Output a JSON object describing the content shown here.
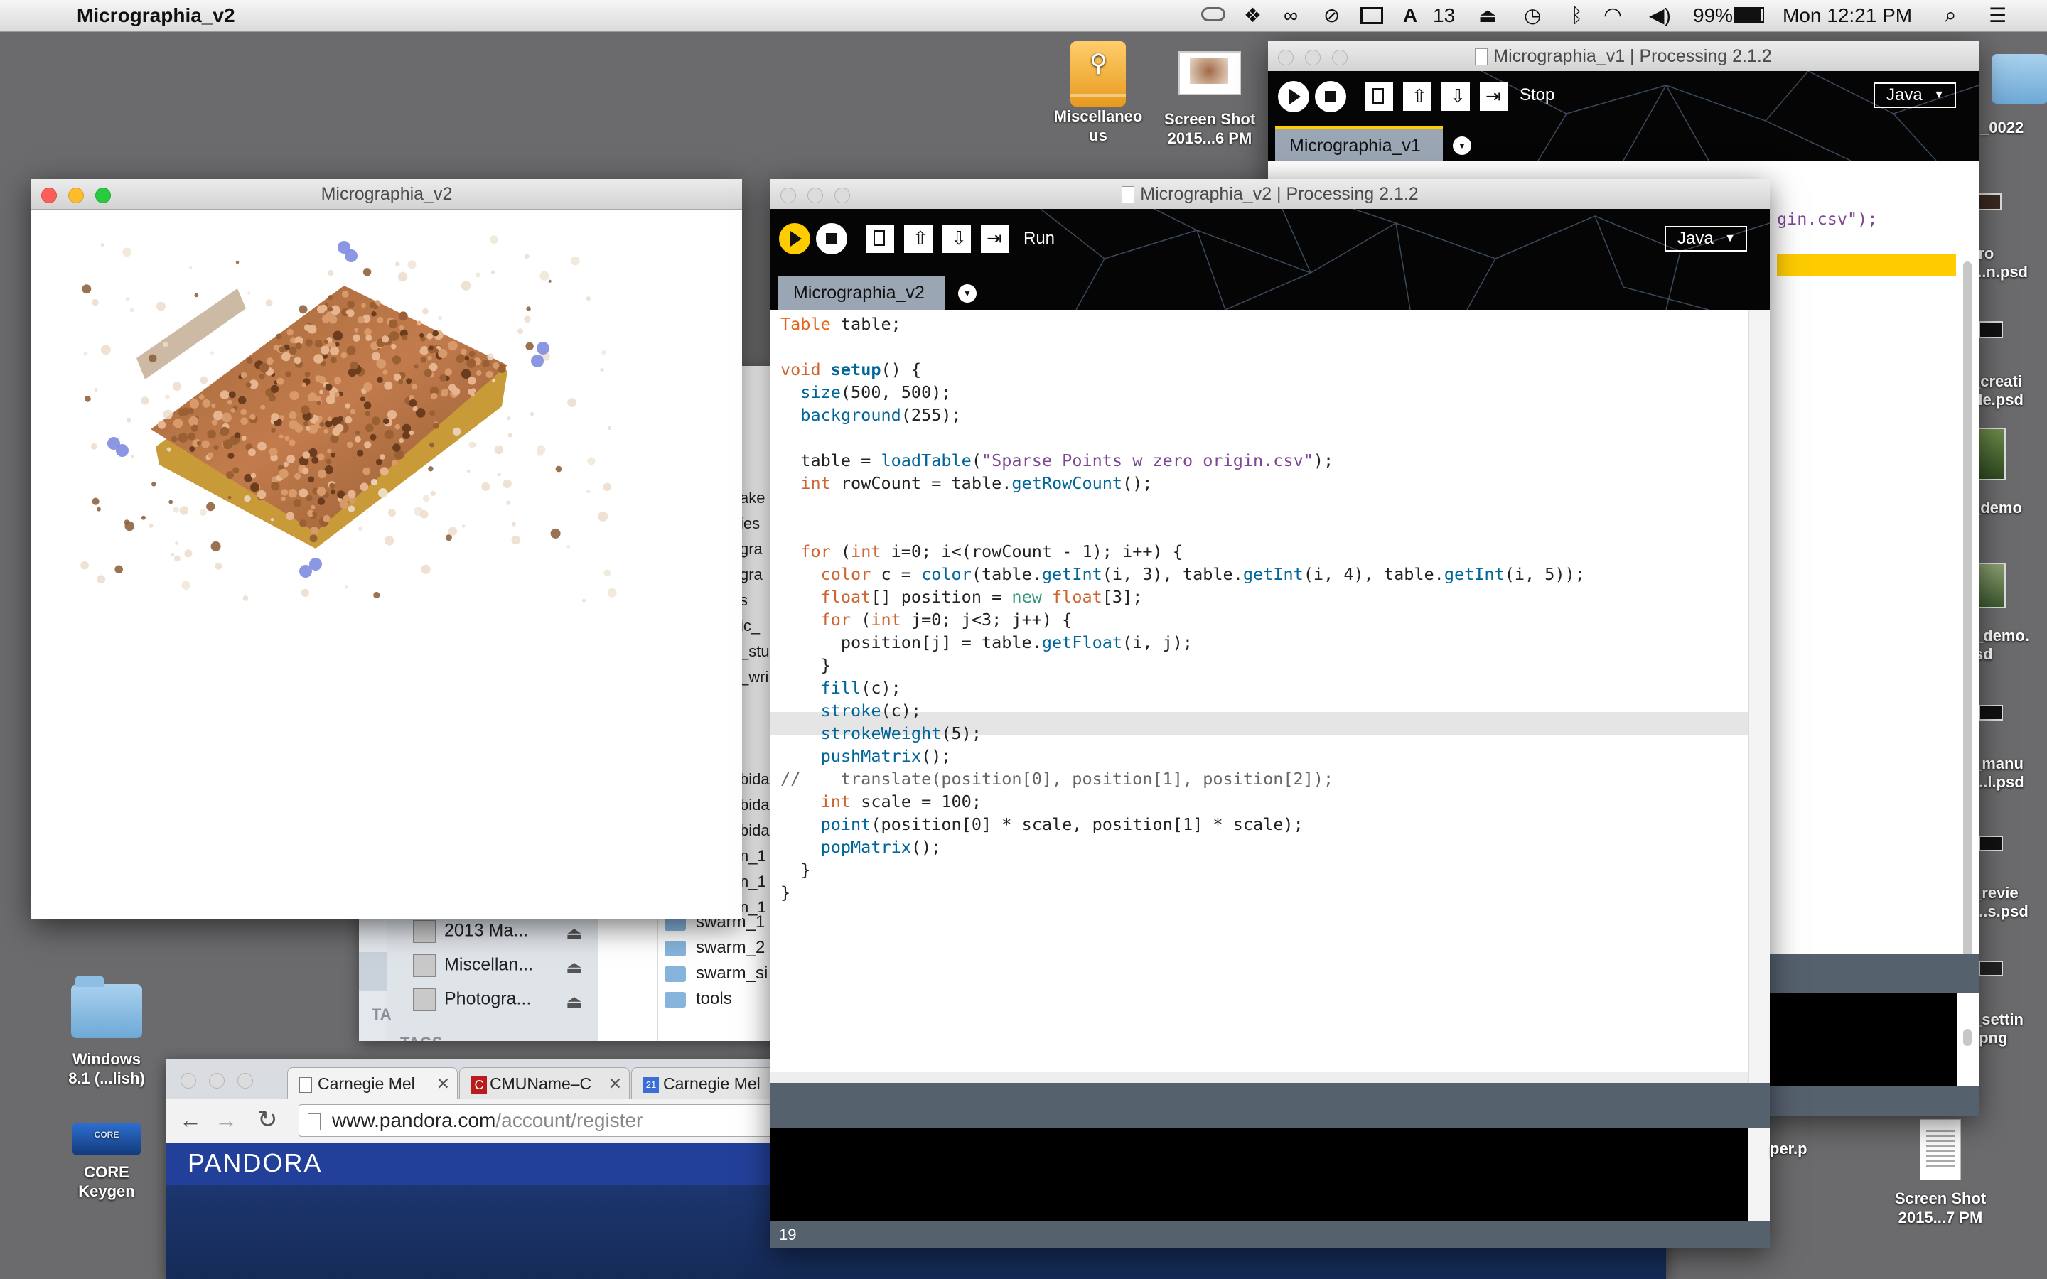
{
  "menubar": {
    "app_name": "Micrographia_v2",
    "status_icons": [
      "cloud-icon",
      "dropbox-icon",
      "creative-cloud-icon",
      "sync-icon",
      "display-icon",
      "adobe-icon",
      "airplay-icon",
      "time-machine-icon",
      "bluetooth-icon",
      "wifi-icon",
      "volume-icon"
    ],
    "adobe_count": "13",
    "battery": "99%",
    "clock": "Mon 12:21 PM"
  },
  "desktop": {
    "icons": [
      {
        "label_line1": "Miscellaneo",
        "label_line2": "us",
        "icon": "usb-drive-icon"
      },
      {
        "label_line1": "Screen Shot",
        "label_line2": "2015...6 PM",
        "icon": "screenshot-thumb"
      },
      {
        "label_line1": "Windows",
        "label_line2": "8.1 (...lish)",
        "icon": "folder-icon"
      },
      {
        "label_line1": "CORE",
        "label_line2": "Keygen",
        "icon": "keygen-icon"
      },
      {
        "label_line1": "Screen Shot",
        "label_line2": "2015...7 PM",
        "icon": "document-thumb"
      },
      {
        "label_line1": "_0022",
        "icon": "folder-icon"
      }
    ],
    "right_edge_labels": [
      "tro",
      "...n.psd",
      "_creati",
      "de.psd",
      "_demo",
      "_demo.",
      "sd",
      "_manu",
      "...l.psd",
      "_revie",
      "...s.psd",
      "_settin",
      ".png",
      "per.p"
    ]
  },
  "sketch_window": {
    "title": "Micrographia_v2"
  },
  "editor_v1": {
    "title": "Micrographia_v1 | Processing 2.1.2",
    "stop_label": "Stop",
    "mode": "Java",
    "tab": "Micrographia_v1",
    "snippet": "gin.csv\");"
  },
  "editor_v2": {
    "title": "Micrographia_v2 | Processing 2.1.2",
    "run_label": "Run",
    "mode": "Java",
    "tab": "Micrographia_v2",
    "line_number": "19"
  },
  "finder": {
    "sidebar_items": [
      "2013 Ma...",
      "Miscellan...",
      "Photogra..."
    ],
    "tags_label": "TAGS",
    "tags_short": "TA",
    "files": [
      "swarm_1",
      "swarm_2",
      "swarm_si",
      "tools"
    ],
    "partial_names": [
      "ake",
      "ies",
      "gra",
      "gra",
      "s",
      "ic_",
      "_stu",
      "_wri",
      "bida",
      "bida",
      "bida",
      "n_1",
      "n_1",
      "n_1"
    ]
  },
  "browser": {
    "tabs": [
      "Carnegie Mel",
      "CMUName–C",
      "Carnegie Mel"
    ],
    "url_host": "www.pandora.com",
    "url_path": "/account/register",
    "brand": "PANDORA"
  }
}
